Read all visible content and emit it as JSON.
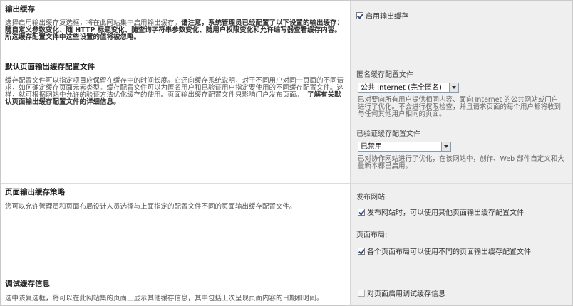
{
  "sections": {
    "output_cache": {
      "title": "输出缓存",
      "desc_plain": "选择启用输出缓存复选框，将在此网站集中启用输出缓存。",
      "desc_bold": "请注意，系统管理员已经配置了以下设置的输出缓存：随自定义参数变化、随 HTTP 标题变化、随查询字符串参数变化、随用户权限变化和允许编写器查看缓存内容。所选缓存配置文件中这些设置的值将被忽略。",
      "enable_label": "启用输出缓存",
      "enabled": true
    },
    "default_profile": {
      "title": "默认页面输出缓存配置文件",
      "desc_plain": "缓存配置文件可以指定项目应保留在缓存中的时间长度。它还向缓存系统说明，对于不同用户对同一页面的不同请求，如何确定缓存页面元素类型。缓存配置文件可以为匿名用户和已验证用户指定要使用的不同缓存配置文件。这样，就可根据网站中允许的验证方法优化缓存的使用。页面输出缓存配置文件只影响门户发布页面。",
      "desc_link": "了解有关默认页面输出缓存配置文件的详细信息。",
      "anon_label": "匿名缓存配置文件",
      "anon_value": "公共 Internet (完全匿名)",
      "anon_hint": "已对要向所有用户提供相同内容、面向 Internet 的公共网站或门户进行了优化。不会进行权限检查，并且请求页面的每个用户都将收到与任何其他用户相同的页面。",
      "auth_label": "已验证缓存配置文件",
      "auth_value": "已禁用",
      "auth_hint": "已对协作网站进行了优化，在该网站中，创作、Web 部件自定义和大量新本都已启用。"
    },
    "page_policy": {
      "title": "页面输出缓存策略",
      "desc": "您可以允许管理员和页面布局设计人员选择与上面指定的配置文件不同的页面输出缓存配置文件。",
      "publish_heading": "发布网站:",
      "publish_label": "发布网站时，可以使用其他页面输出缓存配置文件",
      "publish_checked": true,
      "layout_heading": "页面布局:",
      "layout_label": "各个页面布局可以使用不同的页面输出缓存配置文件",
      "layout_checked": true
    },
    "debug": {
      "title": "调试缓存信息",
      "desc": "选中该复选框，将可以在此网站集的页面上显示其他缓存信息，其中包括上次呈现页面内容的日期和时间。",
      "debug_label": "对页面启用调试缓存信息",
      "debug_checked": false
    }
  },
  "colors": {
    "right_panel_bg": "#efefef",
    "select_border": "#7f9db9",
    "check_mark": "#2b4a8a"
  }
}
